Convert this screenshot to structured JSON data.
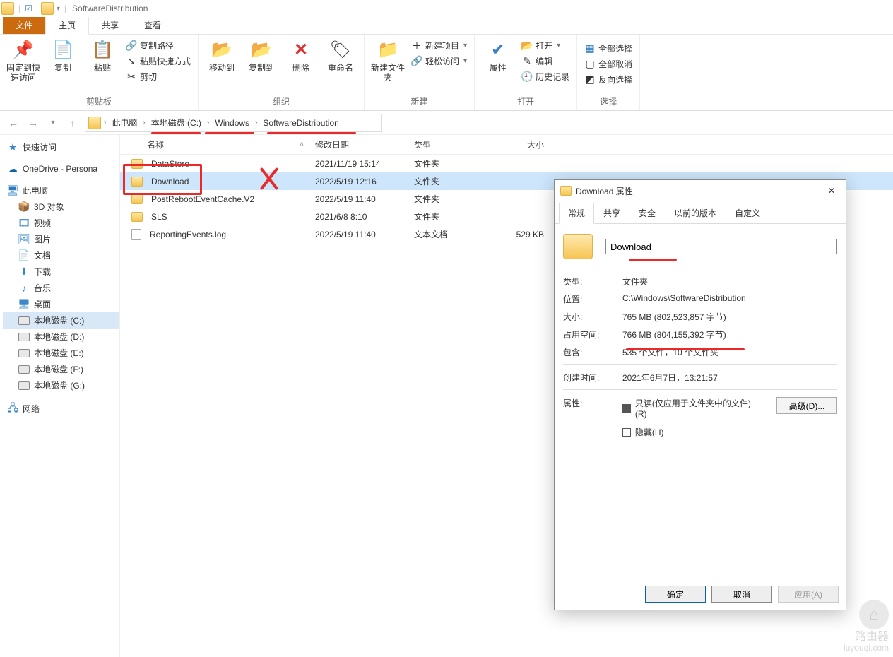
{
  "title": "SoftwareDistribution",
  "tabs": {
    "file": "文件",
    "home": "主页",
    "share": "共享",
    "view": "查看"
  },
  "ribbon": {
    "clipboard": {
      "pin": "固定到快速访问",
      "copy": "复制",
      "paste": "粘贴",
      "copypath": "复制路径",
      "pasteshortcut": "粘贴快捷方式",
      "cut": "剪切",
      "group": "剪贴板"
    },
    "organize": {
      "moveto": "移动到",
      "copyto": "复制到",
      "delete": "删除",
      "rename": "重命名",
      "group": "组织"
    },
    "new": {
      "newfolder": "新建文件夹",
      "newitem": "新建项目",
      "easyaccess": "轻松访问",
      "group": "新建"
    },
    "open": {
      "properties": "属性",
      "open": "打开",
      "edit": "编辑",
      "history": "历史记录",
      "group": "打开"
    },
    "select": {
      "selectall": "全部选择",
      "selectnone": "全部取消",
      "invert": "反向选择",
      "group": "选择"
    }
  },
  "breadcrumb": [
    "此电脑",
    "本地磁盘 (C:)",
    "Windows",
    "SoftwareDistribution"
  ],
  "columns": {
    "name": "名称",
    "date": "修改日期",
    "type": "类型",
    "size": "大小"
  },
  "files": [
    {
      "name": "DataStore",
      "date": "2021/11/19 15:14",
      "type": "文件夹",
      "size": "",
      "kind": "folder"
    },
    {
      "name": "Download",
      "date": "2022/5/19 12:16",
      "type": "文件夹",
      "size": "",
      "kind": "folder",
      "selected": true
    },
    {
      "name": "PostRebootEventCache.V2",
      "date": "2022/5/19 11:40",
      "type": "文件夹",
      "size": "",
      "kind": "folder"
    },
    {
      "name": "SLS",
      "date": "2021/6/8 8:10",
      "type": "文件夹",
      "size": "",
      "kind": "folder"
    },
    {
      "name": "ReportingEvents.log",
      "date": "2022/5/19 11:40",
      "type": "文本文档",
      "size": "529 KB",
      "kind": "file"
    }
  ],
  "tree": {
    "quick": "快速访问",
    "onedrive": "OneDrive - Persona",
    "thispc": "此电脑",
    "items": [
      "3D 对象",
      "视频",
      "图片",
      "文档",
      "下载",
      "音乐",
      "桌面"
    ],
    "disks": [
      "本地磁盘 (C:)",
      "本地磁盘 (D:)",
      "本地磁盘 (E:)",
      "本地磁盘 (F:)",
      "本地磁盘 (G:)"
    ],
    "network": "网络"
  },
  "dialog": {
    "title": "Download 属性",
    "tabs": [
      "常规",
      "共享",
      "安全",
      "以前的版本",
      "自定义"
    ],
    "name": "Download",
    "rows": {
      "typeL": "类型:",
      "typeV": "文件夹",
      "locL": "位置:",
      "locV": "C:\\Windows\\SoftwareDistribution",
      "sizeL": "大小:",
      "sizeV": "765 MB (802,523,857 字节)",
      "diskL": "占用空间:",
      "diskV": "766 MB (804,155,392 字节)",
      "containsL": "包含:",
      "containsV": "535 个文件，10 个文件夹",
      "createdL": "创建时间:",
      "createdV": "2021年6月7日，13:21:57",
      "attrL": "属性:"
    },
    "readonly": "只读(仅应用于文件夹中的文件)(R)",
    "hidden": "隐藏(H)",
    "advanced": "高级(D)...",
    "ok": "确定",
    "cancel": "取消",
    "apply": "应用(A)"
  },
  "watermark": {
    "brand": "路由器",
    "domain": "luyouqi.com"
  }
}
